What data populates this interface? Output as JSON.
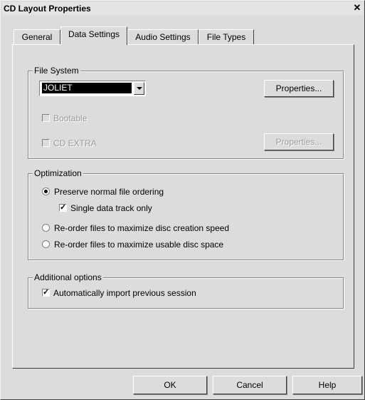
{
  "window": {
    "title": "CD Layout Properties",
    "close_glyph": "✕"
  },
  "tabs": [
    {
      "label": "General",
      "active": false
    },
    {
      "label": "Data Settings",
      "active": true
    },
    {
      "label": "Audio Settings",
      "active": false
    },
    {
      "label": "File Types",
      "active": false
    }
  ],
  "file_system": {
    "group_label": "File System",
    "selected": "JOLIET",
    "properties_label": "Properties...",
    "bootable_label": "Bootable",
    "bootable_checked": false,
    "cd_extra_label": "CD EXTRA",
    "cd_extra_checked": false,
    "cd_extra_properties_label": "Properties..."
  },
  "optimization": {
    "group_label": "Optimization",
    "options": [
      {
        "label": "Preserve normal file ordering",
        "checked": true
      },
      {
        "label": "Re-order files to maximize disc creation speed",
        "checked": false
      },
      {
        "label": "Re-order files to maximize usable disc space",
        "checked": false
      }
    ],
    "single_track_label": "Single data track only",
    "single_track_checked": true
  },
  "additional": {
    "group_label": "Additional options",
    "import_label": "Automatically import previous session",
    "import_checked": true
  },
  "footer": {
    "ok_label": "OK",
    "cancel_label": "Cancel",
    "help_label": "Help"
  },
  "colors": {
    "dialog_bg": "#dcdcdc",
    "selection_bg": "#000000",
    "disabled_text": "#9a9a9a"
  }
}
